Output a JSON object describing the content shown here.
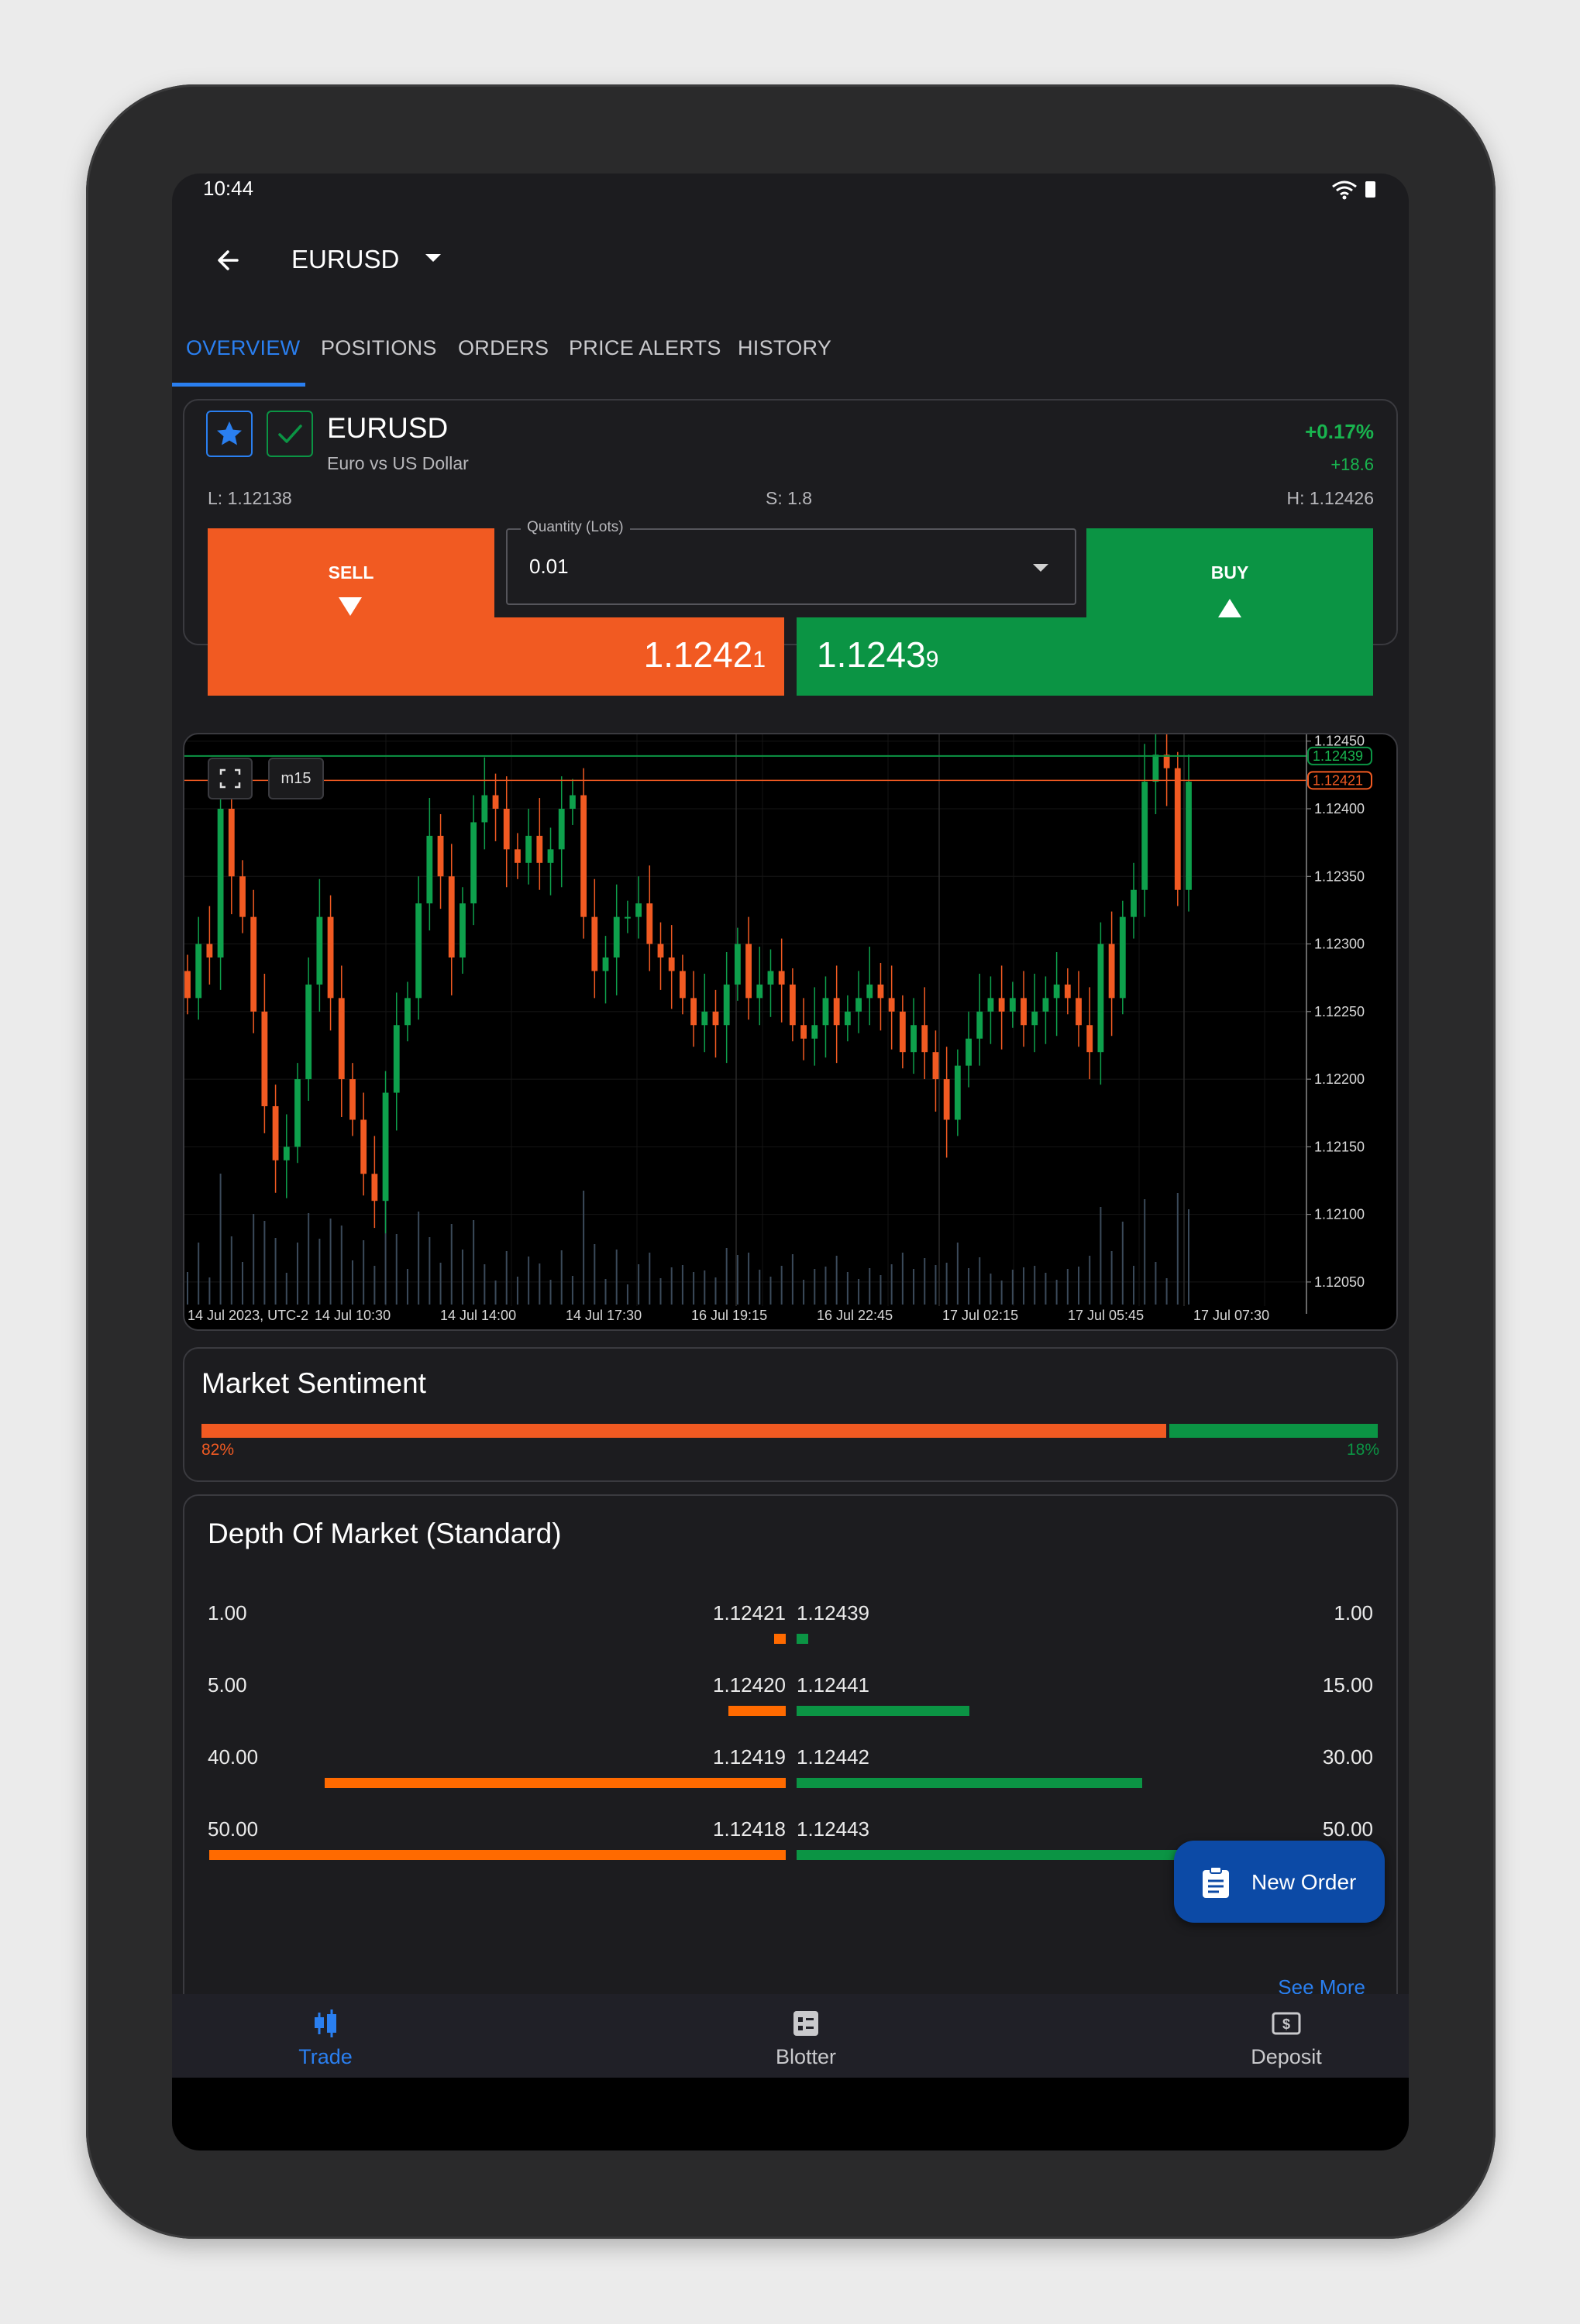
{
  "status_bar": {
    "time": "10:44"
  },
  "header": {
    "title": "EURUSD"
  },
  "tabs": [
    {
      "label": "OVERVIEW",
      "active": true
    },
    {
      "label": "POSITIONS"
    },
    {
      "label": "ORDERS"
    },
    {
      "label": "PRICE ALERTS"
    },
    {
      "label": "HISTORY"
    }
  ],
  "instrument": {
    "symbol": "EURUSD",
    "description": "Euro vs US Dollar",
    "change_pct": "+0.17%",
    "change_pips": "+18.6",
    "low": "L: 1.12138",
    "spread": "S: 1.8",
    "high": "H: 1.12426"
  },
  "trade": {
    "sell_label": "SELL",
    "buy_label": "BUY",
    "quantity_label": "Quantity (Lots)",
    "quantity_value": "0.01",
    "sell_price_main": "1.1242",
    "sell_price_pip": "1",
    "buy_price_main": "1.1243",
    "buy_price_pip": "9"
  },
  "chart": {
    "timeframe": "m15",
    "current_buy_marker": "1.12439",
    "current_sell_marker": "1.12421"
  },
  "chart_data": {
    "type": "candlestick",
    "timezone_label": "14 Jul 2023, UTC-2",
    "x_labels": [
      "14 Jul 10:30",
      "14 Jul 14:00",
      "14 Jul 17:30",
      "16 Jul 19:15",
      "16 Jul 22:45",
      "17 Jul 02:15",
      "17 Jul 05:45",
      "17 Jul 07:30"
    ],
    "y_ticks": [
      "1.12450",
      "1.12400",
      "1.12350",
      "1.12300",
      "1.12250",
      "1.12200",
      "1.12150",
      "1.12100",
      "1.12050"
    ],
    "ylim": [
      1.12015,
      1.12455
    ],
    "closes": [
      1.1226,
      1.123,
      1.1229,
      1.124,
      1.1235,
      1.1232,
      1.1225,
      1.1218,
      1.1214,
      1.1215,
      1.122,
      1.1227,
      1.1232,
      1.1226,
      1.122,
      1.1217,
      1.1213,
      1.1211,
      1.1219,
      1.1224,
      1.1226,
      1.1233,
      1.1238,
      1.1235,
      1.1229,
      1.1233,
      1.1239,
      1.1241,
      1.124,
      1.1237,
      1.1236,
      1.1238,
      1.1236,
      1.1237,
      1.124,
      1.1241,
      1.1232,
      1.1228,
      1.1229,
      1.1232,
      1.1232,
      1.1233,
      1.123,
      1.1229,
      1.1228,
      1.1226,
      1.1224,
      1.1225,
      1.1224,
      1.1227,
      1.123,
      1.1226,
      1.1227,
      1.1228,
      1.1227,
      1.1224,
      1.1223,
      1.1224,
      1.1226,
      1.1224,
      1.1225,
      1.1226,
      1.1227,
      1.1226,
      1.1225,
      1.1222,
      1.1224,
      1.1222,
      1.122,
      1.1217,
      1.1221,
      1.1223,
      1.1225,
      1.1226,
      1.1225,
      1.1226,
      1.1224,
      1.1225,
      1.1226,
      1.1227,
      1.1226,
      1.1224,
      1.1222,
      1.123,
      1.1226,
      1.1232,
      1.1234,
      1.1242,
      1.1244,
      1.1243,
      1.1234,
      1.1242
    ],
    "volume_note": "volume histogram at bottom"
  },
  "sentiment": {
    "title": "Market Sentiment",
    "sell_pct": "82%",
    "buy_pct": "18%",
    "sell_value": 0.82,
    "buy_value": 0.18
  },
  "depth": {
    "title": "Depth Of Market (Standard)",
    "rows": [
      {
        "sell_volume": "1.00",
        "sell_price": "1.12421",
        "buy_price": "1.12439",
        "buy_volume": "1.00",
        "sell_level": 1,
        "buy_level": 1
      },
      {
        "sell_volume": "5.00",
        "sell_price": "1.12420",
        "buy_price": "1.12441",
        "buy_volume": "15.00",
        "sell_level": 5,
        "buy_level": 15
      },
      {
        "sell_volume": "40.00",
        "sell_price": "1.12419",
        "buy_price": "1.12442",
        "buy_volume": "30.00",
        "sell_level": 40,
        "buy_level": 30
      },
      {
        "sell_volume": "50.00",
        "sell_price": "1.12418",
        "buy_price": "1.12443",
        "buy_volume": "50.00",
        "sell_level": 50,
        "buy_level": 50
      }
    ],
    "see_more": "See More"
  },
  "fab": {
    "label": "New Order"
  },
  "bottom_nav": [
    {
      "label": "Trade",
      "active": true
    },
    {
      "label": "Blotter"
    },
    {
      "label": "Deposit"
    }
  ],
  "colors": {
    "sell": "#f15a22",
    "buy": "#0b9444",
    "accent": "#2a7ff0",
    "fab": "#0c4aa6"
  }
}
